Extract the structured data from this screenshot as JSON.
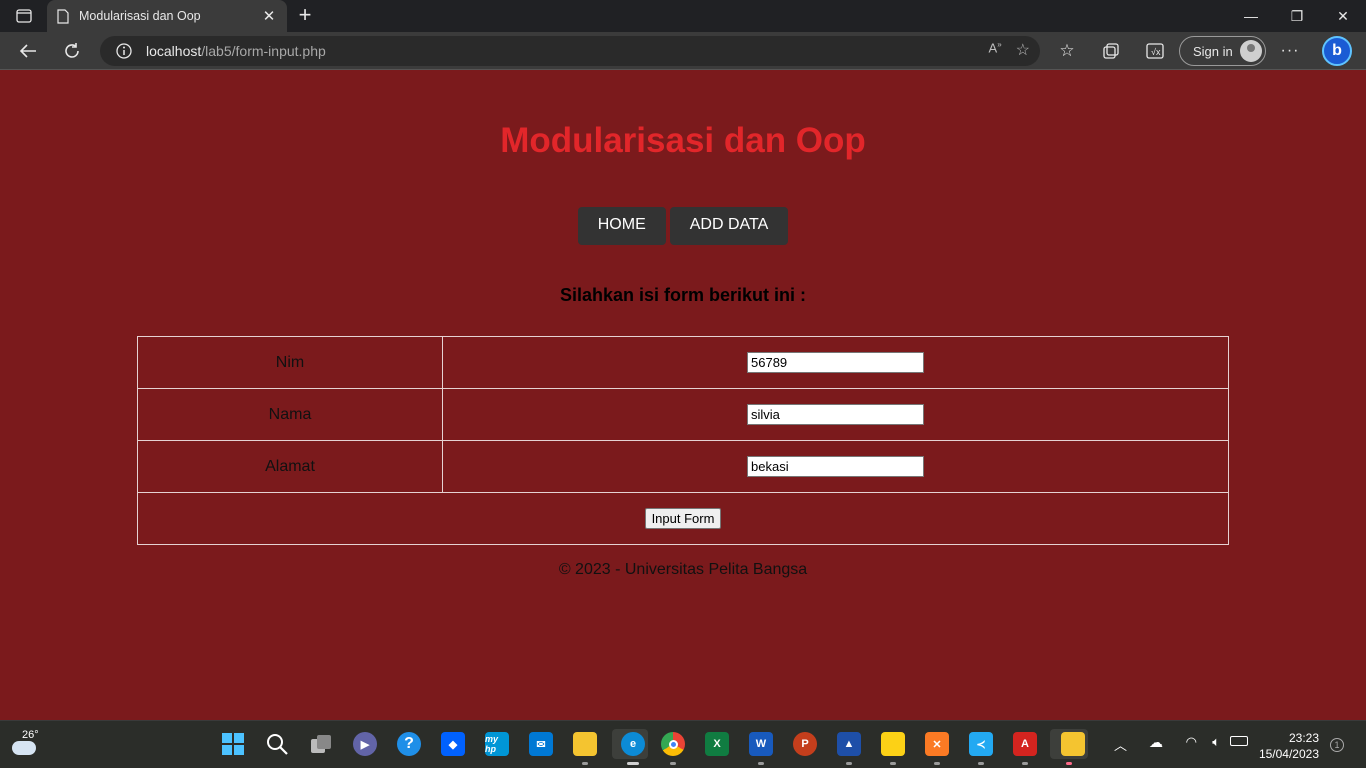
{
  "browser": {
    "tab_title": "Modularisasi dan Oop",
    "url_host": "localhost",
    "url_path": "/lab5/form-input.php",
    "signin_label": "Sign in"
  },
  "page": {
    "title": "Modularisasi dan Oop",
    "nav": [
      {
        "label": "HOME"
      },
      {
        "label": "ADD DATA"
      }
    ],
    "subheading": "Silahkan isi form berikut ini :",
    "form": {
      "rows": [
        {
          "label": "Nim",
          "value": "56789"
        },
        {
          "label": "Nama",
          "value": "silvia"
        },
        {
          "label": "Alamat",
          "value": "bekasi"
        }
      ],
      "submit_label": "Input Form"
    },
    "footer": "© 2023 - Universitas Pelita Bangsa"
  },
  "taskbar": {
    "weather_temp": "26°",
    "time": "23:23",
    "date": "15/04/2023",
    "notification_count": "1"
  },
  "colors": {
    "page_bg": "#7b1a1c",
    "title_red": "#e2262a",
    "nav_bg": "#333333"
  }
}
